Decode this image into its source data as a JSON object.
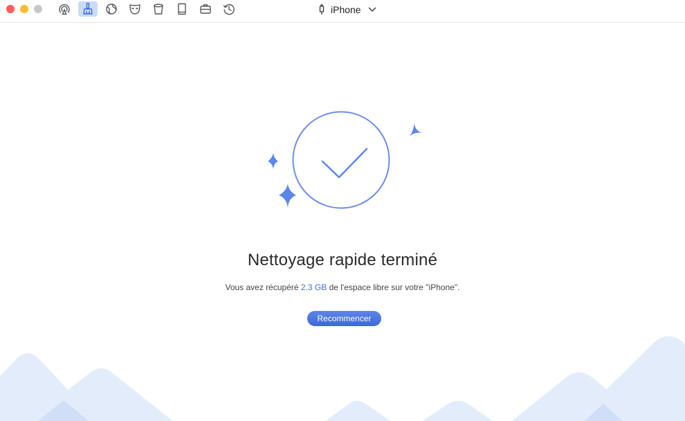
{
  "toolbar": {
    "traffic_lights": {
      "close_color": "#fc5f57",
      "minimize_color": "#fdbc2e",
      "zoom_color": "#c8c8c8"
    },
    "tools": [
      {
        "icon": "airplay-icon",
        "active": false
      },
      {
        "icon": "broom-icon",
        "active": true
      },
      {
        "icon": "globe-icon",
        "active": false
      },
      {
        "icon": "mask-icon",
        "active": false
      },
      {
        "icon": "trash-bin-icon",
        "active": false
      },
      {
        "icon": "book-icon",
        "active": false
      },
      {
        "icon": "toolbox-icon",
        "active": false
      },
      {
        "icon": "history-icon",
        "active": false
      }
    ],
    "device_name": "iPhone"
  },
  "main": {
    "title": "Nettoyage rapide terminé",
    "subtitle_prefix": "Vous avez récupéré ",
    "recovered_amount": "2.3 GB",
    "subtitle_suffix": " de l'espace libre sur votre \"iPhone\".",
    "restart_label": "Recommencer"
  },
  "colors": {
    "accent": "#5b86ea",
    "highlight": "#3f6fd6",
    "mountains_light": "#e6eefb",
    "mountains_dark": "#d3e1f8"
  }
}
